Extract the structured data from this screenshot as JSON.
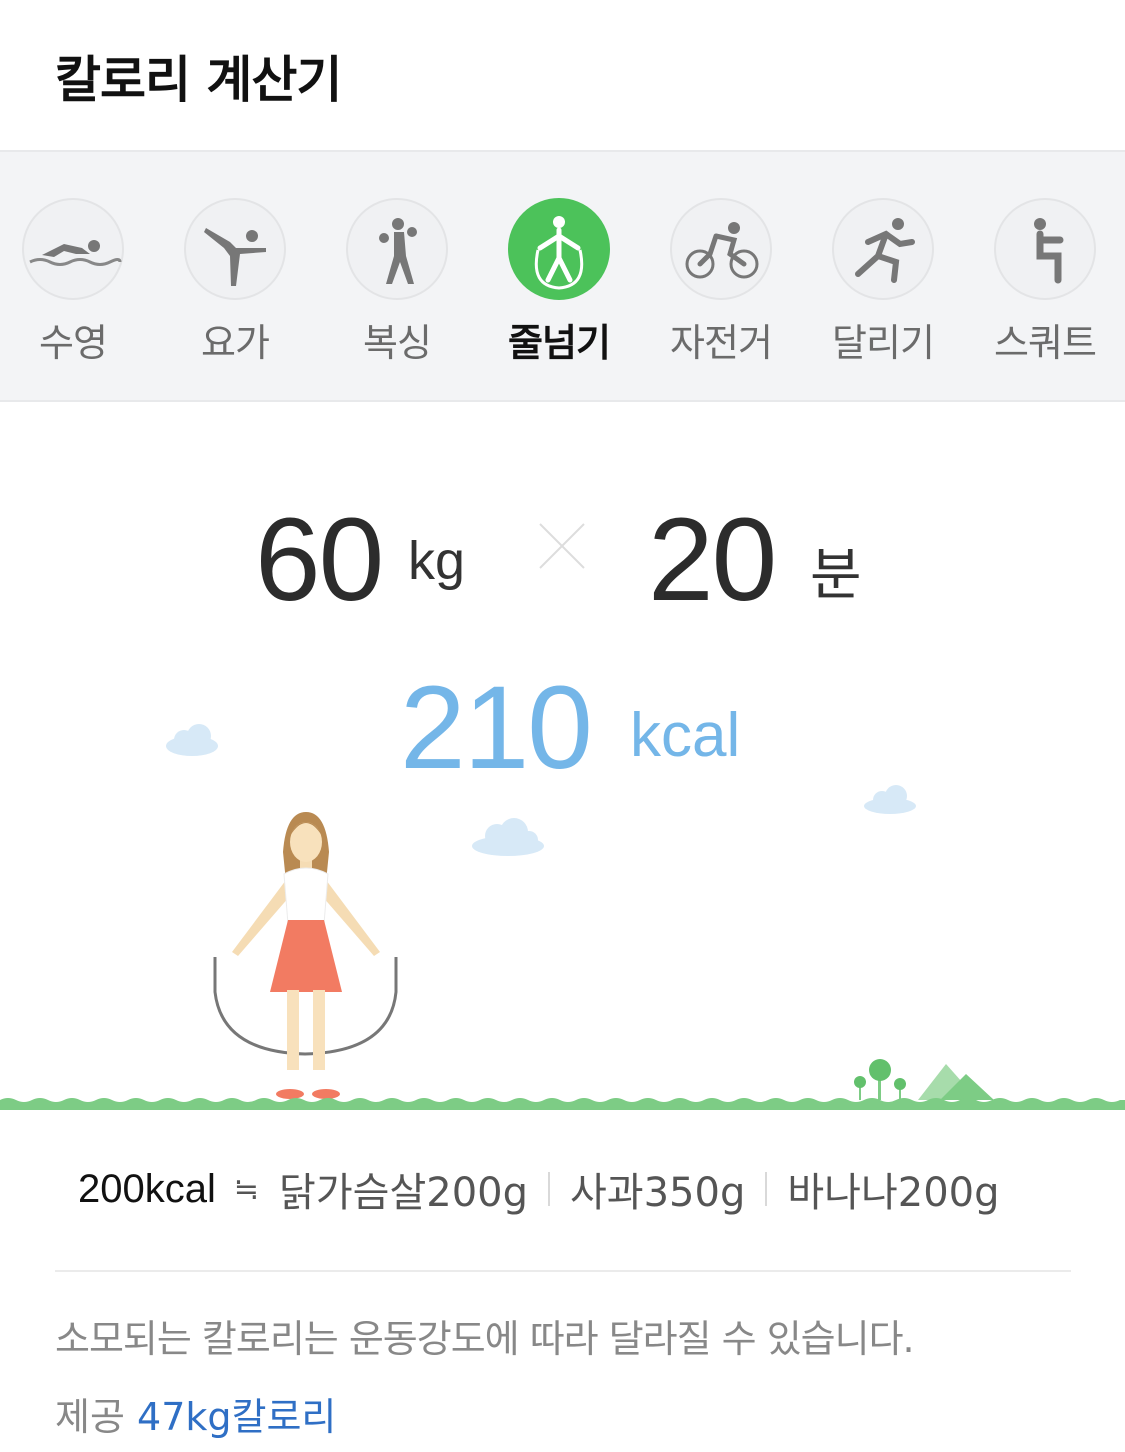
{
  "header": {
    "title": "칼로리 계산기"
  },
  "tabs": [
    {
      "label": "수영",
      "icon": "swimming-icon",
      "active": false
    },
    {
      "label": "요가",
      "icon": "yoga-icon",
      "active": false
    },
    {
      "label": "복싱",
      "icon": "boxing-icon",
      "active": false
    },
    {
      "label": "줄넘기",
      "icon": "jump-rope-icon",
      "active": true
    },
    {
      "label": "자전거",
      "icon": "cycling-icon",
      "active": false
    },
    {
      "label": "달리기",
      "icon": "running-icon",
      "active": false
    },
    {
      "label": "스쿼트",
      "icon": "squat-icon",
      "active": false
    }
  ],
  "calculator": {
    "weight": "60",
    "weight_unit": "kg",
    "minutes": "20",
    "minutes_unit": "분",
    "kcal": "210",
    "kcal_unit": "kcal"
  },
  "equivalents": {
    "base": "200kcal",
    "approx_symbol": "≒",
    "foods": [
      "닭가슴살200g",
      "사과350g",
      "바나나200g"
    ]
  },
  "notice": "소모되는 칼로리는 운동강도에 따라 달라질 수 있습니다.",
  "provider": {
    "label": "제공",
    "link_text": "47kg칼로리"
  },
  "colors": {
    "active_tab": "#4cc25a",
    "kcal_text": "#74b6e8",
    "link": "#2f6fc5",
    "ground": "#7dcc85"
  }
}
